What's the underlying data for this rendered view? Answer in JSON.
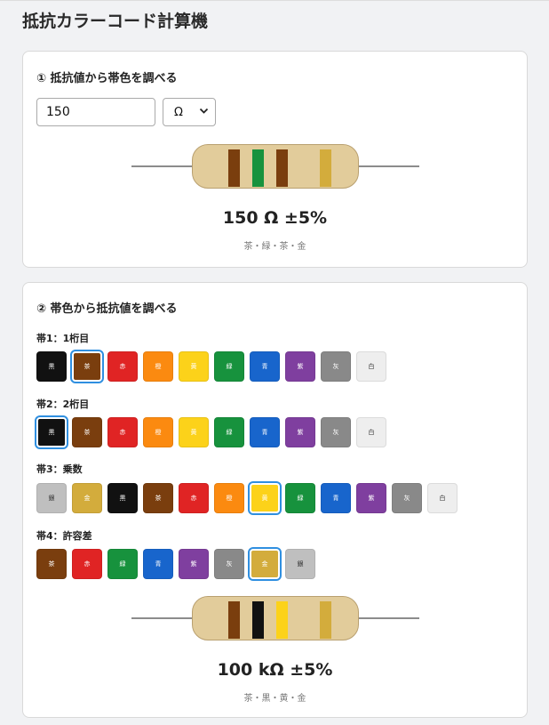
{
  "app_title": "抵抗カラーコード計算機",
  "card1": {
    "title": "① 抵抗値から帯色を調べる",
    "input_value": "150",
    "unit": "Ω",
    "bands": [
      "#7a3e0e",
      "#17923d",
      "#7a3e0e",
      "#d3ac3c"
    ],
    "result": "150 Ω ±5%",
    "band_names": "茶・緑・茶・金"
  },
  "card2": {
    "title": "② 帯色から抵抗値を調べる",
    "groups": [
      {
        "label": "帯1：1桁目",
        "selected": 1,
        "swatches": [
          {
            "name": "黒",
            "color": "#111111"
          },
          {
            "name": "茶",
            "color": "#7a3e0e"
          },
          {
            "name": "赤",
            "color": "#e02424"
          },
          {
            "name": "橙",
            "color": "#fb8a10"
          },
          {
            "name": "黄",
            "color": "#fcd21a"
          },
          {
            "name": "緑",
            "color": "#17923d"
          },
          {
            "name": "青",
            "color": "#1865cc"
          },
          {
            "name": "紫",
            "color": "#7f3f9f"
          },
          {
            "name": "灰",
            "color": "#898989"
          },
          {
            "name": "白",
            "color": "#eeeeee"
          }
        ]
      },
      {
        "label": "帯2：2桁目",
        "selected": 0,
        "swatches": [
          {
            "name": "黒",
            "color": "#111111"
          },
          {
            "name": "茶",
            "color": "#7a3e0e"
          },
          {
            "name": "赤",
            "color": "#e02424"
          },
          {
            "name": "橙",
            "color": "#fb8a10"
          },
          {
            "name": "黄",
            "color": "#fcd21a"
          },
          {
            "name": "緑",
            "color": "#17923d"
          },
          {
            "name": "青",
            "color": "#1865cc"
          },
          {
            "name": "紫",
            "color": "#7f3f9f"
          },
          {
            "name": "灰",
            "color": "#898989"
          },
          {
            "name": "白",
            "color": "#eeeeee"
          }
        ]
      },
      {
        "label": "帯3：乗数",
        "selected": 6,
        "swatches": [
          {
            "name": "銀",
            "color": "#bfbfbf"
          },
          {
            "name": "金",
            "color": "#d3ac3c"
          },
          {
            "name": "黒",
            "color": "#111111"
          },
          {
            "name": "茶",
            "color": "#7a3e0e"
          },
          {
            "name": "赤",
            "color": "#e02424"
          },
          {
            "name": "橙",
            "color": "#fb8a10"
          },
          {
            "name": "黄",
            "color": "#fcd21a"
          },
          {
            "name": "緑",
            "color": "#17923d"
          },
          {
            "name": "青",
            "color": "#1865cc"
          },
          {
            "name": "紫",
            "color": "#7f3f9f"
          },
          {
            "name": "灰",
            "color": "#898989"
          },
          {
            "name": "白",
            "color": "#eeeeee"
          }
        ]
      },
      {
        "label": "帯4：許容差",
        "selected": 6,
        "swatches": [
          {
            "name": "茶",
            "color": "#7a3e0e"
          },
          {
            "name": "赤",
            "color": "#e02424"
          },
          {
            "name": "緑",
            "color": "#17923d"
          },
          {
            "name": "青",
            "color": "#1865cc"
          },
          {
            "name": "紫",
            "color": "#7f3f9f"
          },
          {
            "name": "灰",
            "color": "#898989"
          },
          {
            "name": "金",
            "color": "#d3ac3c"
          },
          {
            "name": "銀",
            "color": "#bfbfbf"
          }
        ]
      }
    ],
    "bands": [
      "#7a3e0e",
      "#111111",
      "#fcd21a",
      "#d3ac3c"
    ],
    "result": "100 kΩ ±5%",
    "band_names": "茶・黒・黄・金"
  }
}
